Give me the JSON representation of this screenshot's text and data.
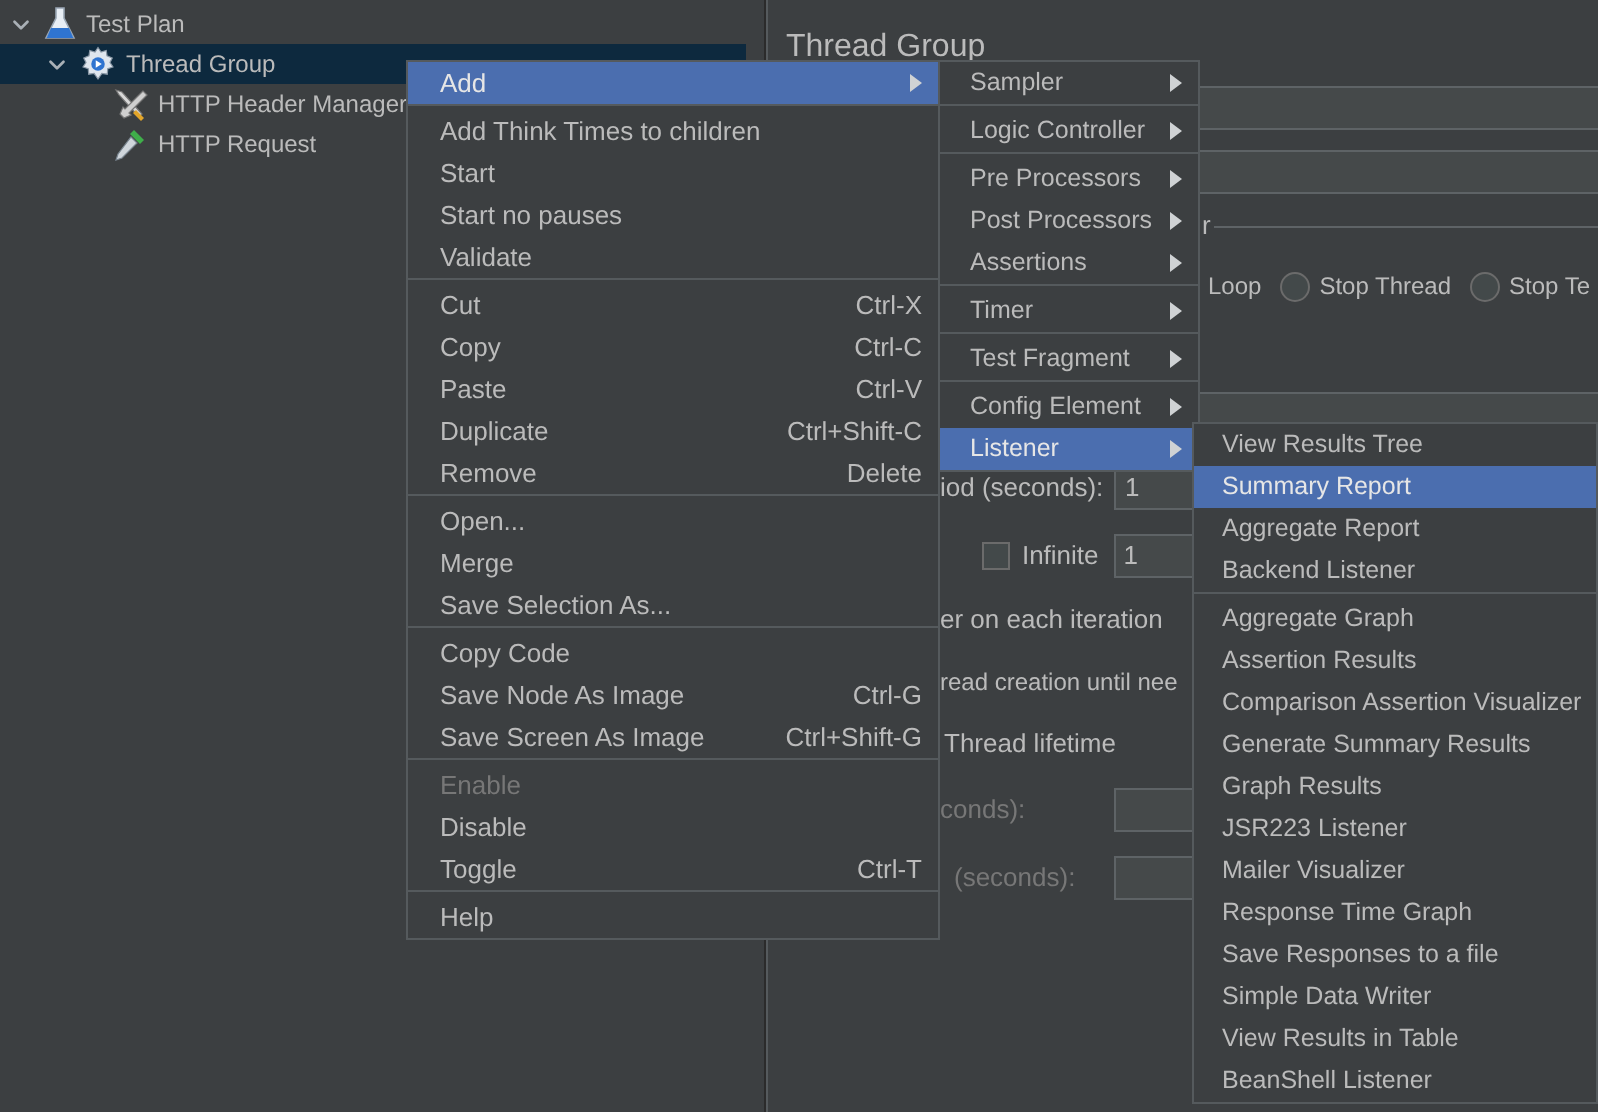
{
  "tree": [
    {
      "label": "Test Plan",
      "expanded": true,
      "selected": false,
      "children": [
        {
          "label": "Thread Group",
          "expanded": true,
          "selected": true,
          "children": [
            {
              "label": "HTTP Header Manager",
              "selected": false
            },
            {
              "label": "HTTP Request",
              "selected": false
            }
          ]
        }
      ]
    }
  ],
  "panel": {
    "title": "Thread Group",
    "error_action": {
      "legend": "r",
      "options": [
        {
          "label": "Loop",
          "kind": "text"
        },
        {
          "label": "Stop Thread",
          "kind": "radio",
          "selected": false
        },
        {
          "label": "Stop Te",
          "kind": "radio",
          "selected": false
        }
      ]
    },
    "ramp_up": {
      "label": "iod (seconds):",
      "value": "1"
    },
    "loop_count": {
      "infinite_label": "Infinite",
      "infinite_checked": false,
      "value": "1"
    },
    "same_user": {
      "label": "er on each iteration"
    },
    "delay": {
      "label": "read creation until nee"
    },
    "lifetime": {
      "label": "Thread lifetime"
    },
    "duration": {
      "label": "conds):",
      "disabled": true
    },
    "startup_delay": {
      "label": "(seconds):",
      "disabled": true
    }
  },
  "context_menu": {
    "groups": [
      [
        {
          "label": "Add",
          "submenu": true,
          "selected": true,
          "disabled": false
        }
      ],
      [
        {
          "label": "Add Think Times to children",
          "submenu": false,
          "selected": false,
          "disabled": false
        },
        {
          "label": "Start",
          "submenu": false,
          "selected": false,
          "disabled": false
        },
        {
          "label": "Start no pauses",
          "submenu": false,
          "selected": false,
          "disabled": false
        },
        {
          "label": "Validate",
          "submenu": false,
          "selected": false,
          "disabled": false
        }
      ],
      [
        {
          "label": "Cut",
          "shortcut": "Ctrl-X",
          "submenu": false,
          "selected": false,
          "disabled": false
        },
        {
          "label": "Copy",
          "shortcut": "Ctrl-C",
          "submenu": false,
          "selected": false,
          "disabled": false
        },
        {
          "label": "Paste",
          "shortcut": "Ctrl-V",
          "submenu": false,
          "selected": false,
          "disabled": false
        },
        {
          "label": "Duplicate",
          "shortcut": "Ctrl+Shift-C",
          "submenu": false,
          "selected": false,
          "disabled": false
        },
        {
          "label": "Remove",
          "shortcut": "Delete",
          "submenu": false,
          "selected": false,
          "disabled": false
        }
      ],
      [
        {
          "label": "Open...",
          "submenu": false,
          "selected": false,
          "disabled": false
        },
        {
          "label": "Merge",
          "submenu": false,
          "selected": false,
          "disabled": false
        },
        {
          "label": "Save Selection As...",
          "submenu": false,
          "selected": false,
          "disabled": false
        }
      ],
      [
        {
          "label": "Copy Code",
          "submenu": false,
          "selected": false,
          "disabled": false
        },
        {
          "label": "Save Node As Image",
          "shortcut": "Ctrl-G",
          "submenu": false,
          "selected": false,
          "disabled": false
        },
        {
          "label": "Save Screen As Image",
          "shortcut": "Ctrl+Shift-G",
          "submenu": false,
          "selected": false,
          "disabled": false
        }
      ],
      [
        {
          "label": "Enable",
          "submenu": false,
          "selected": false,
          "disabled": true
        },
        {
          "label": "Disable",
          "submenu": false,
          "selected": false,
          "disabled": false
        },
        {
          "label": "Toggle",
          "shortcut": "Ctrl-T",
          "submenu": false,
          "selected": false,
          "disabled": false
        }
      ],
      [
        {
          "label": "Help",
          "submenu": false,
          "selected": false,
          "disabled": false
        }
      ]
    ]
  },
  "add_menu": {
    "groups": [
      [
        {
          "label": "Sampler",
          "submenu": true,
          "selected": false
        }
      ],
      [
        {
          "label": "Logic Controller",
          "submenu": true,
          "selected": false
        }
      ],
      [
        {
          "label": "Pre Processors",
          "submenu": true,
          "selected": false
        },
        {
          "label": "Post Processors",
          "submenu": true,
          "selected": false
        },
        {
          "label": "Assertions",
          "submenu": true,
          "selected": false
        }
      ],
      [
        {
          "label": "Timer",
          "submenu": true,
          "selected": false
        }
      ],
      [
        {
          "label": "Test Fragment",
          "submenu": true,
          "selected": false
        }
      ],
      [
        {
          "label": "Config Element",
          "submenu": true,
          "selected": false
        },
        {
          "label": "Listener",
          "submenu": true,
          "selected": true
        }
      ]
    ]
  },
  "listener_menu": {
    "groups": [
      [
        {
          "label": "View Results Tree",
          "selected": false
        },
        {
          "label": "Summary Report",
          "selected": true
        },
        {
          "label": "Aggregate Report",
          "selected": false
        },
        {
          "label": "Backend Listener",
          "selected": false
        }
      ],
      [
        {
          "label": "Aggregate Graph",
          "selected": false
        },
        {
          "label": "Assertion Results",
          "selected": false
        },
        {
          "label": "Comparison Assertion Visualizer",
          "selected": false
        },
        {
          "label": "Generate Summary Results",
          "selected": false
        },
        {
          "label": "Graph Results",
          "selected": false
        },
        {
          "label": "JSR223 Listener",
          "selected": false
        },
        {
          "label": "Mailer Visualizer",
          "selected": false
        },
        {
          "label": "Response Time Graph",
          "selected": false
        },
        {
          "label": "Save Responses to a file",
          "selected": false
        },
        {
          "label": "Simple Data Writer",
          "selected": false
        },
        {
          "label": "View Results in Table",
          "selected": false
        },
        {
          "label": "BeanShell Listener",
          "selected": false
        }
      ]
    ]
  }
}
